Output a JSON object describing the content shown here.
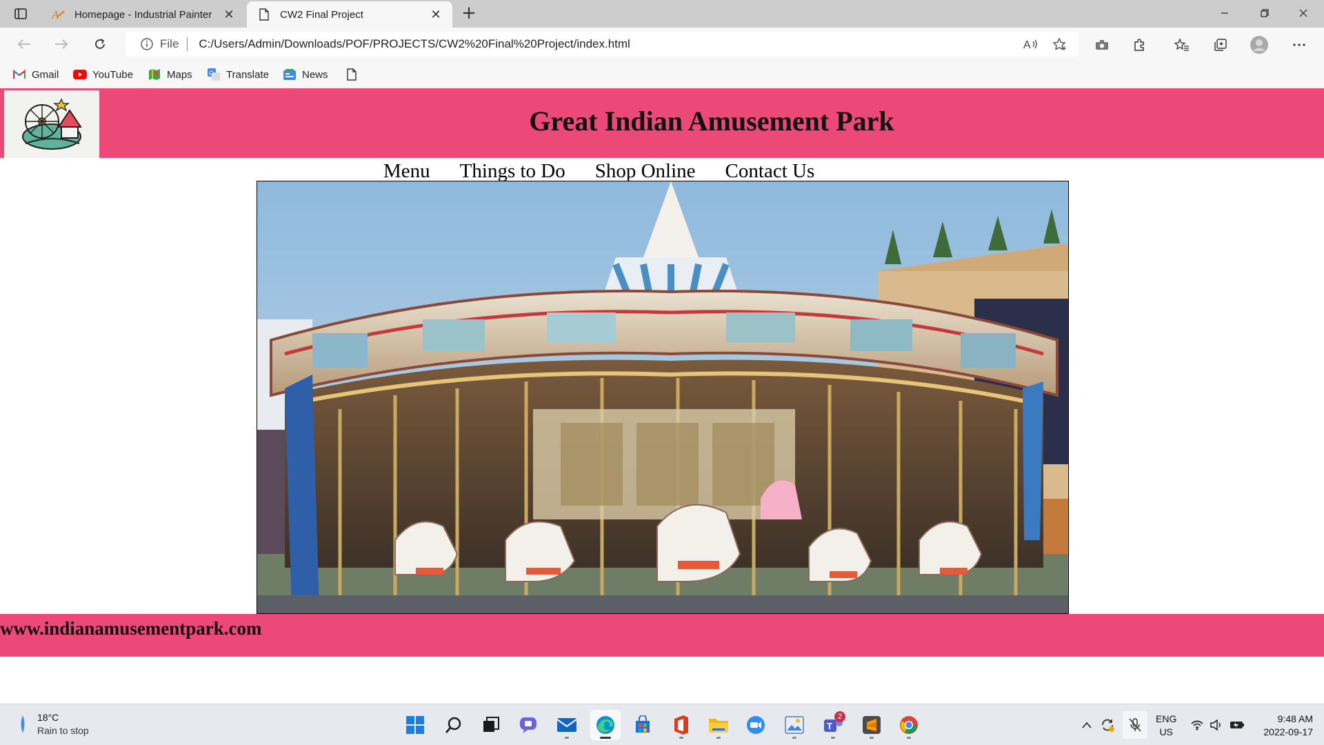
{
  "browser": {
    "tabs": [
      {
        "title": "Homepage - Industrial Painter",
        "icon": "site-logo-icon",
        "active": false
      },
      {
        "title": "CW2 Final Project",
        "icon": "page-icon",
        "active": true
      }
    ],
    "url_scheme": "File",
    "url": "C:/Users/Admin/Downloads/POF/PROJECTS/CW2%20Final%20Project/index.html",
    "bookmarks": [
      {
        "label": "Gmail",
        "icon": "gmail-icon"
      },
      {
        "label": "YouTube",
        "icon": "youtube-icon"
      },
      {
        "label": "Maps",
        "icon": "maps-icon"
      },
      {
        "label": "Translate",
        "icon": "translate-icon"
      },
      {
        "label": "News",
        "icon": "news-icon"
      }
    ]
  },
  "site": {
    "title": "Great Indian Amusement Park",
    "nav": [
      "Menu",
      "Things to Do",
      "Shop Online",
      "Contact Us"
    ],
    "footer_url": "www.indianamusementpark.com",
    "accent_color": "#ec4978"
  },
  "taskbar": {
    "weather_temp": "18°C",
    "weather_desc": "Rain to stop",
    "lang_top": "ENG",
    "lang_bottom": "US",
    "time": "9:48 AM",
    "date": "2022-09-17",
    "teams_badge": "2"
  }
}
